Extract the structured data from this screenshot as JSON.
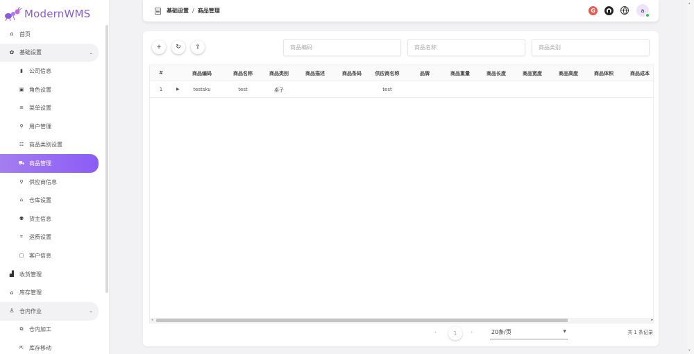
{
  "app": {
    "name": "ModernWMS"
  },
  "sidebar": {
    "items": [
      {
        "label": "首页",
        "icon": "home-icon",
        "glyph": "⌂",
        "level": "top",
        "state": ""
      },
      {
        "label": "基础设置",
        "icon": "gear-icon",
        "glyph": "✿",
        "level": "top",
        "state": "group"
      },
      {
        "label": "公司信息",
        "icon": "building-icon",
        "glyph": "▮",
        "level": "sub",
        "state": ""
      },
      {
        "label": "角色设置",
        "icon": "badge-icon",
        "glyph": "▣",
        "level": "sub",
        "state": ""
      },
      {
        "label": "菜单设置",
        "icon": "menu-icon",
        "glyph": "≡",
        "level": "sub",
        "state": ""
      },
      {
        "label": "用户管理",
        "icon": "user-icon",
        "glyph": "⚲",
        "level": "sub",
        "state": ""
      },
      {
        "label": "商品类别设置",
        "icon": "list-icon",
        "glyph": "☷",
        "level": "sub",
        "state": ""
      },
      {
        "label": "商品管理",
        "icon": "cart-icon",
        "glyph": "⛟",
        "level": "sub",
        "state": "active"
      },
      {
        "label": "供应商信息",
        "icon": "supplier-icon",
        "glyph": "⚲",
        "level": "sub",
        "state": ""
      },
      {
        "label": "仓库设置",
        "icon": "warehouse-icon",
        "glyph": "⌂",
        "level": "sub",
        "state": ""
      },
      {
        "label": "货主信息",
        "icon": "owners-icon",
        "glyph": "⚉",
        "level": "sub",
        "state": ""
      },
      {
        "label": "运费设置",
        "icon": "freight-icon",
        "glyph": "⌗",
        "level": "sub",
        "state": ""
      },
      {
        "label": "客户信息",
        "icon": "customer-icon",
        "glyph": "▢",
        "level": "sub",
        "state": ""
      },
      {
        "label": "收货管理",
        "icon": "receiving-icon",
        "glyph": "▟",
        "level": "top",
        "state": ""
      },
      {
        "label": "库存管理",
        "icon": "inventory-icon",
        "glyph": "⌂",
        "level": "top",
        "state": ""
      },
      {
        "label": "仓内作业",
        "icon": "operation-icon",
        "glyph": "♙",
        "level": "top",
        "state": "group"
      },
      {
        "label": "仓内加工",
        "icon": "processing-icon",
        "glyph": "⧉",
        "level": "sub",
        "state": ""
      },
      {
        "label": "库存移动",
        "icon": "move-icon",
        "glyph": "⇱",
        "level": "sub",
        "state": ""
      }
    ]
  },
  "header": {
    "breadcrumb_parent": "基础设置",
    "breadcrumb_sep": "/",
    "breadcrumb_current": "商品管理",
    "g_label": "G",
    "avatar_letter": "a"
  },
  "toolbar": {
    "add": "+",
    "refresh": "↻",
    "export": "⇪"
  },
  "search": {
    "code_placeholder": "商品编码",
    "name_placeholder": "商品名称",
    "category_placeholder": "商品类别"
  },
  "table": {
    "columns": [
      "#",
      "商品编码",
      "商品名称",
      "商品类别",
      "商品描述",
      "商品条码",
      "供应商名称",
      "品牌",
      "商品重量",
      "商品长度",
      "商品宽度",
      "商品高度",
      "商品体积",
      "商品成本"
    ],
    "rows": [
      {
        "index": "1",
        "expand": "▶",
        "sku": "testsku",
        "name": "test",
        "category": "桌子",
        "supplier": "test"
      }
    ]
  },
  "pager": {
    "prev": "‹",
    "current": "1",
    "next": "›",
    "page_size": "20条/页",
    "total": "共 1 条记录"
  }
}
